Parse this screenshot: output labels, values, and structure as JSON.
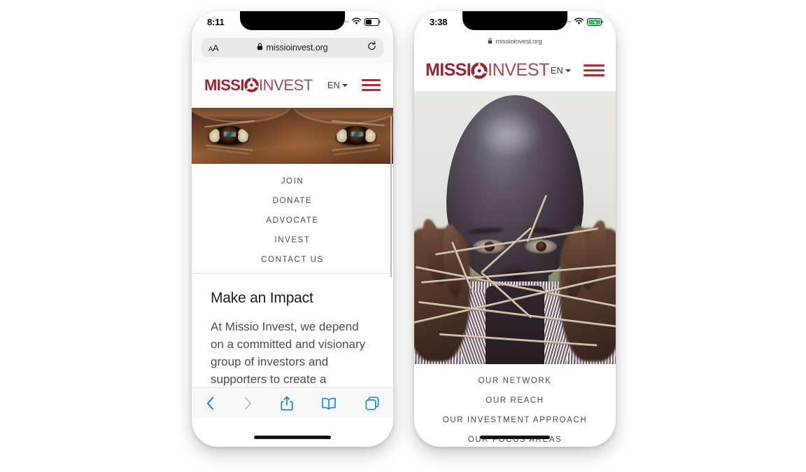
{
  "scene": {
    "background": "#ffffff",
    "device_count": 2
  },
  "brand": {
    "logo_bold": "MISSI",
    "logo_mark": "O",
    "logo_light": "INVEST",
    "color_bold": "#9e2430",
    "color_light": "#a94a4f",
    "accent": "#c0262f"
  },
  "left_phone": {
    "status": {
      "time": "8:11",
      "cellular_icon": "cellular-dots-icon",
      "wifi_icon": "wifi-icon",
      "battery_icon": "battery-icon",
      "battery_charging": false
    },
    "browser": {
      "text_size_button": "AA",
      "lock_icon": "lock-icon",
      "url": "missioinvest.org",
      "reload_icon": "reload-icon"
    },
    "header": {
      "lang": "EN",
      "lang_caret_icon": "chevron-down-icon",
      "menu_icon": "hamburger-menu-icon"
    },
    "hero": {
      "alt": "close-up photograph of a person's eyes"
    },
    "nav_items": [
      {
        "label": "JOIN"
      },
      {
        "label": "DONATE"
      },
      {
        "label": "ADVOCATE"
      },
      {
        "label": "INVEST"
      },
      {
        "label": "CONTACT US"
      }
    ],
    "article": {
      "heading": "Make an Impact",
      "body": "At Missio Invest, we depend on a committed and visionary group of investors and supporters to create a powerful, sustainable impact in communities."
    },
    "toolbar": [
      {
        "icon": "back-chevron-icon",
        "enabled": true
      },
      {
        "icon": "forward-chevron-icon",
        "enabled": false
      },
      {
        "icon": "share-icon",
        "enabled": true
      },
      {
        "icon": "bookmarks-icon",
        "enabled": true
      },
      {
        "icon": "tabs-icon",
        "enabled": true
      }
    ]
  },
  "right_phone": {
    "status": {
      "time": "3:38",
      "cellular_icon": "cellular-dots-icon",
      "wifi_icon": "wifi-icon",
      "battery_icon": "battery-charging-icon",
      "battery_charging": true,
      "battery_color": "#34c759"
    },
    "browser": {
      "lock_icon": "lock-icon",
      "url": "missioinvest.org"
    },
    "header": {
      "lang": "EN",
      "lang_caret_icon": "chevron-down-icon",
      "menu_icon": "hamburger-menu-icon"
    },
    "hero": {
      "alt": "child playing a cat's cradle string game"
    },
    "nav_items": [
      {
        "label": "OUR NETWORK"
      },
      {
        "label": "OUR REACH"
      },
      {
        "label": "OUR INVESTMENT APPROACH"
      },
      {
        "label": "OUR FOCUS AREAS"
      }
    ]
  }
}
